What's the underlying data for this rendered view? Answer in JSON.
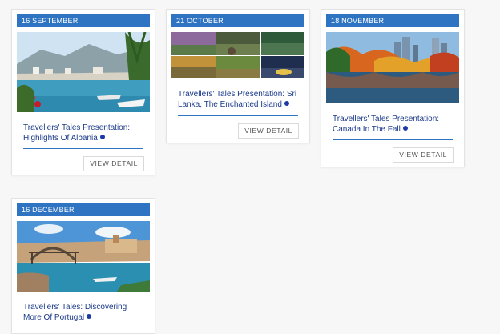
{
  "events": [
    {
      "date": "16 SEPTEMBER",
      "title": "Travellers' Tales Presentation: Highlights Of Albania",
      "button": "VIEW DETAIL",
      "image_icon": "albania-harbour-photo"
    },
    {
      "date": "21 OCTOBER",
      "title": "Travellers' Tales Presentation: Sri Lanka, The Enchanted Island",
      "button": "VIEW DETAIL",
      "image_icon": "sri-lanka-collage-photo"
    },
    {
      "date": "18 NOVEMBER",
      "title": "Travellers' Tales Presentation: Canada In The Fall",
      "button": "VIEW DETAIL",
      "image_icon": "canada-autumn-lake-photo"
    },
    {
      "date": "16 DECEMBER",
      "title": "Travellers' Tales: Discovering More Of Portugal",
      "button": "",
      "image_icon": "portugal-bridge-river-photo"
    }
  ],
  "colors": {
    "date_bar": "#2f74c2",
    "title_text": "#1b3a8a",
    "dot": "#1b3aa8"
  }
}
